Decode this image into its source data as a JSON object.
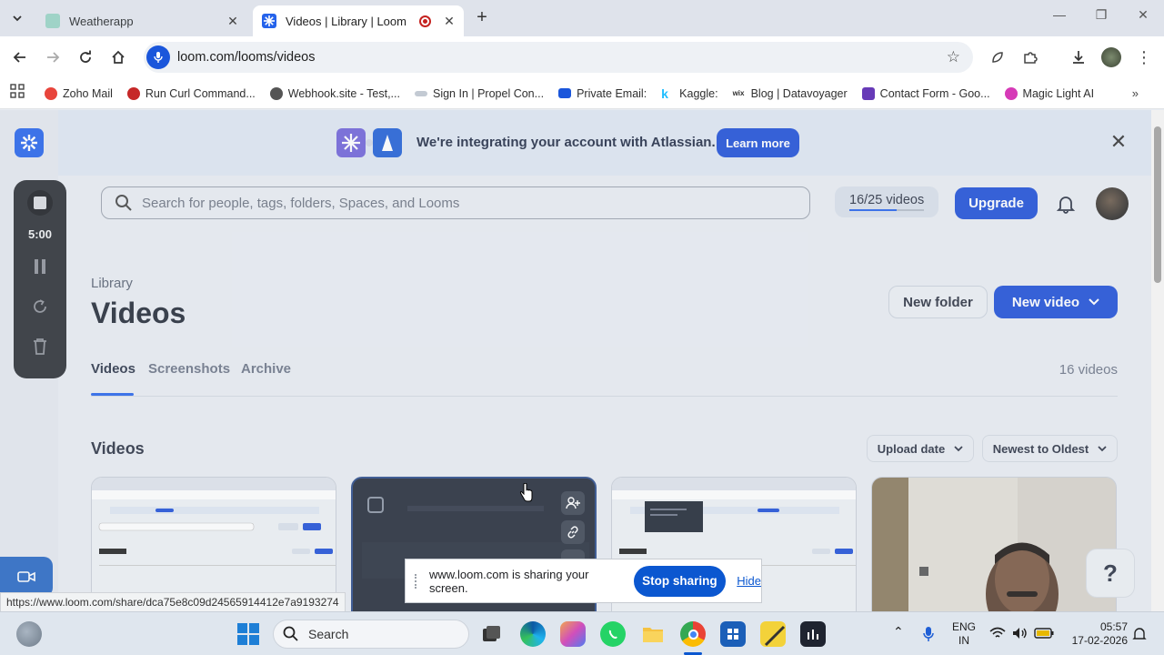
{
  "browser": {
    "tabs": [
      {
        "title": "Weatherapp",
        "active": false
      },
      {
        "title": "Videos | Library | Loom",
        "active": true,
        "recording": true
      }
    ],
    "url": "loom.com/looms/videos",
    "bookmarks": [
      {
        "label": "Zoho Mail",
        "color": "#e8453c"
      },
      {
        "label": "Run Curl Command...",
        "color": "#c62828"
      },
      {
        "label": "Webhook.site - Test,...",
        "color": "#555555"
      },
      {
        "label": "Sign In | Propel Con...",
        "color": "#8e9aa8"
      },
      {
        "label": "Private Email:",
        "color": "#1a56db"
      },
      {
        "label": "Kaggle:",
        "color": "#20beff"
      },
      {
        "label": "Blog | Datavoyager",
        "color": "#222222"
      },
      {
        "label": "Contact Form - Goo...",
        "color": "#673ab7"
      },
      {
        "label": "Magic Light AI",
        "color": "#d63ab7"
      }
    ],
    "status_url": "https://www.loom.com/share/dca75e8c09d24565914412e7a9193274"
  },
  "recorder": {
    "time": "5:00"
  },
  "banner": {
    "text": "We're integrating your account with Atlassian.",
    "button": "Learn more"
  },
  "header": {
    "search_placeholder": "Search for people, tags, folders, Spaces, and Looms",
    "quota_text": "16/25 videos",
    "quota_fraction": 0.64,
    "upgrade": "Upgrade"
  },
  "library": {
    "label": "Library",
    "title": "Videos",
    "new_folder": "New folder",
    "new_video": "New video",
    "tabs": [
      "Videos",
      "Screenshots",
      "Archive"
    ],
    "count": "16 videos",
    "section_title": "Videos",
    "sort_by": "Upload date",
    "sort_order": "Newest to Oldest"
  },
  "share_bar": {
    "text": "www.loom.com is sharing your screen.",
    "stop": "Stop sharing",
    "hide": "Hide"
  },
  "help": "?",
  "taskbar": {
    "search": "Search",
    "lang_1": "ENG",
    "lang_2": "IN",
    "time": "05:57",
    "date": "17-02-2026"
  }
}
